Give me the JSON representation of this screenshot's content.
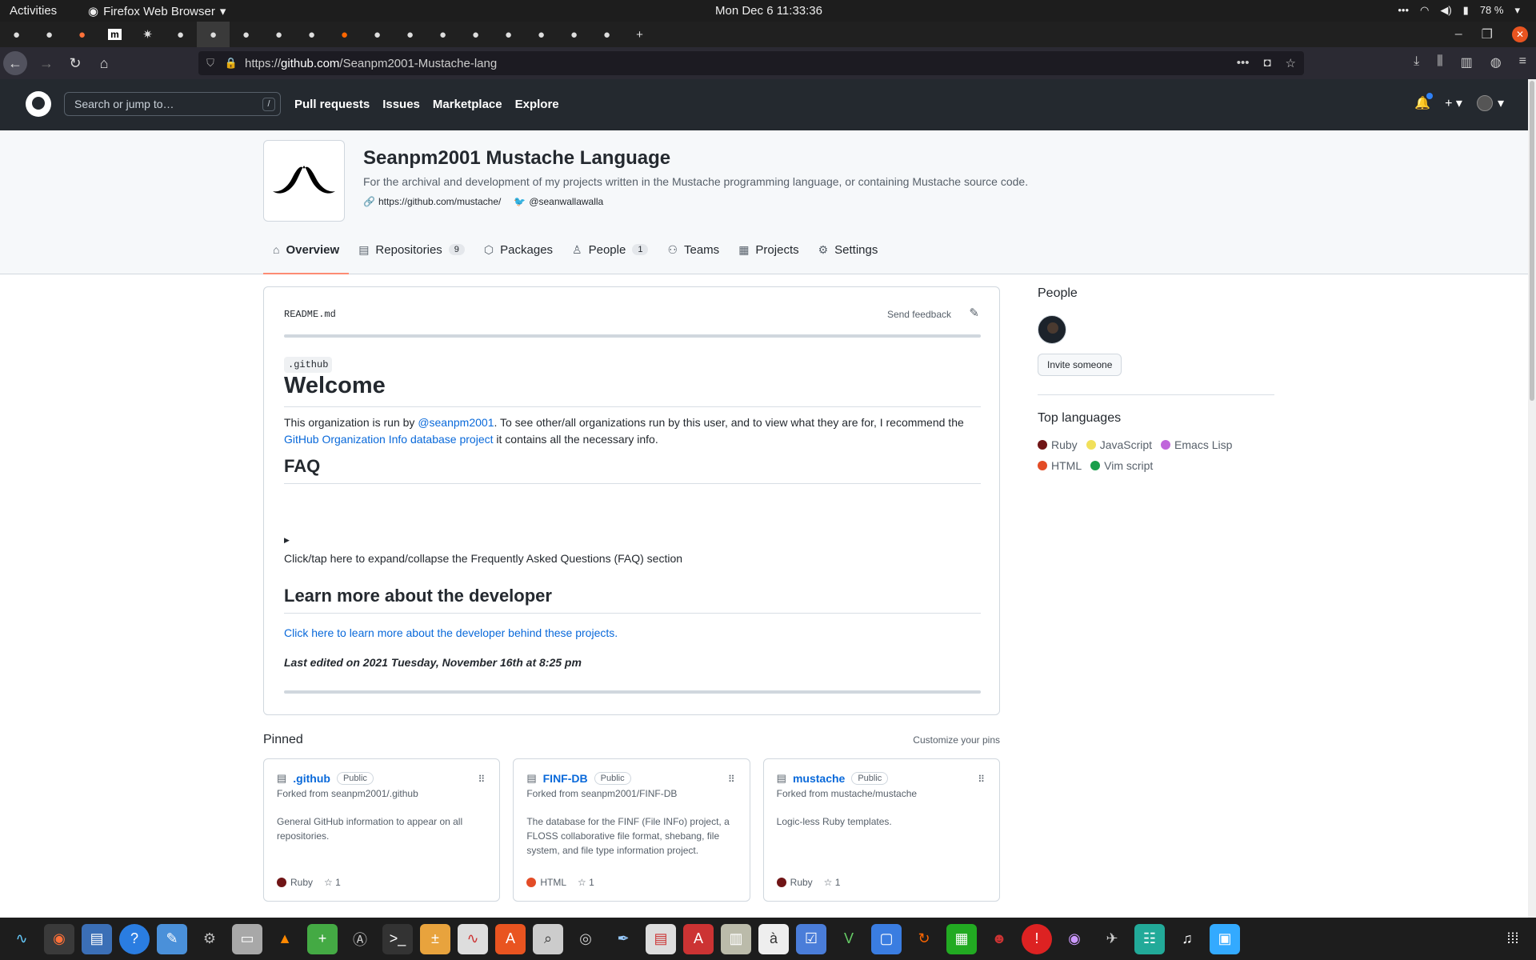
{
  "system": {
    "activities": "Activities",
    "app_name": "Firefox Web Browser",
    "clock": "Mon Dec 6  11:33:36",
    "battery": "78 %"
  },
  "browser": {
    "url_prefix": "https://",
    "url_host": "github.com",
    "url_path": "/Seanpm2001-Mustache-lang"
  },
  "github": {
    "search_placeholder": "Search or jump to…",
    "search_key": "/",
    "nav": [
      "Pull requests",
      "Issues",
      "Marketplace",
      "Explore"
    ]
  },
  "org": {
    "name": "Seanpm2001 Mustache Language",
    "description": "For the archival and development of my projects written in the Mustache programming language, or containing Mustache source code.",
    "link": "https://github.com/mustache/",
    "twitter": "@seanwallawalla",
    "tabs": [
      {
        "label": "Overview",
        "icon": "home-icon"
      },
      {
        "label": "Repositories",
        "count": "9",
        "icon": "repo-icon"
      },
      {
        "label": "Packages",
        "icon": "package-icon"
      },
      {
        "label": "People",
        "count": "1",
        "icon": "person-icon"
      },
      {
        "label": "Teams",
        "icon": "people-icon"
      },
      {
        "label": "Projects",
        "icon": "table-icon"
      },
      {
        "label": "Settings",
        "icon": "gear-icon"
      }
    ]
  },
  "readme": {
    "filename": "README.md",
    "feedback": "Send feedback",
    "code": ".github",
    "h1": "Welcome",
    "p1_a": "This organization is run by ",
    "p1_link": "@seanpm2001",
    "p1_b": ". To see other/all organizations run by this user, and to view what they are for, I recommend the ",
    "p1_link2": "GitHub Organization Info database project",
    "p1_c": " it contains all the necessary info.",
    "faq": "FAQ",
    "faq_summary": "Click/tap here to expand/collapse the Frequently Asked Questions (FAQ) section",
    "dev_heading": "Learn more about the developer",
    "dev_link": "Click here to learn more about the developer behind these projects.",
    "last_edited": "Last edited on 2021 Tuesday, November 16th at 8:25 pm"
  },
  "side": {
    "people_title": "People",
    "invite": "Invite someone",
    "langs_title": "Top languages",
    "langs": [
      {
        "name": "Ruby",
        "color": "#701516"
      },
      {
        "name": "JavaScript",
        "color": "#f1e05a"
      },
      {
        "name": "Emacs Lisp",
        "color": "#c065db"
      },
      {
        "name": "HTML",
        "color": "#e34c26"
      },
      {
        "name": "Vim script",
        "color": "#199f4b"
      }
    ]
  },
  "pinned": {
    "title": "Pinned",
    "customize": "Customize your pins",
    "cards": [
      {
        "name": ".github",
        "vis": "Public",
        "fork": "Forked from seanpm2001/.github",
        "desc": "General GitHub information to appear on all repositories.",
        "lang": "Ruby",
        "lang_color": "#701516",
        "stars": "1"
      },
      {
        "name": "FINF-DB",
        "vis": "Public",
        "fork": "Forked from seanpm2001/FINF-DB",
        "desc": "The database for the FINF (File INFo) project, a FLOSS collaborative file format, shebang, file system, and file type information project.",
        "lang": "HTML",
        "lang_color": "#e34c26",
        "stars": "1"
      },
      {
        "name": "mustache",
        "vis": "Public",
        "fork": "Forked from mustache/mustache",
        "desc": "Logic-less Ruby templates.",
        "lang": "Ruby",
        "lang_color": "#701516",
        "stars": "1"
      }
    ]
  }
}
